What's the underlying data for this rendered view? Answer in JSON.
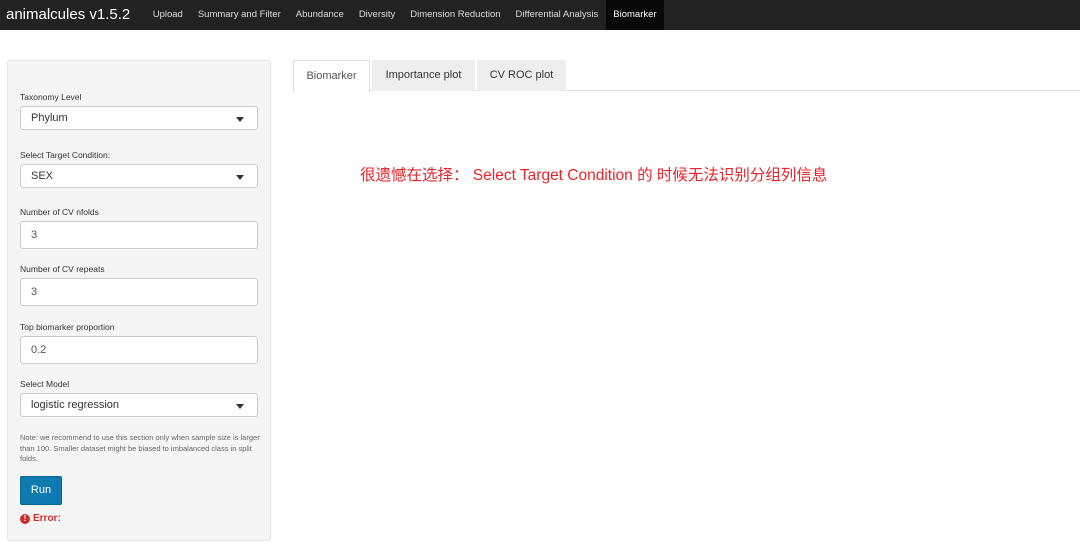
{
  "navbar": {
    "brand": "animalcules v1.5.2",
    "items": [
      {
        "label": "Upload"
      },
      {
        "label": "Summary and Filter"
      },
      {
        "label": "Abundance"
      },
      {
        "label": "Diversity"
      },
      {
        "label": "Dimension Reduction"
      },
      {
        "label": "Differential Analysis"
      },
      {
        "label": "Biomarker"
      }
    ],
    "active": "Biomarker"
  },
  "sidebar": {
    "taxonomy_level": {
      "label": "Taxonomy Level",
      "value": "Phylum"
    },
    "target_condition": {
      "label": "Select Target Condition:",
      "value": "SEX"
    },
    "cv_nfolds": {
      "label": "Number of CV nfolds",
      "value": "3"
    },
    "cv_repeats": {
      "label": "Number of CV repeats",
      "value": "3"
    },
    "top_proportion": {
      "label": "Top biomarker proportion",
      "value": "0.2"
    },
    "model": {
      "label": "Select Model",
      "value": "logistic regression"
    },
    "note": "Note: we recommend to use this section only when sample size is larger than 100. Smaller dataset might be biased to imbalanced class in split folds.",
    "run_label": "Run",
    "error_label": "Error:"
  },
  "tabs": [
    {
      "label": "Biomarker",
      "active": true
    },
    {
      "label": "Importance plot",
      "active": false
    },
    {
      "label": "CV ROC plot",
      "active": false
    }
  ],
  "annotation": "很遗憾在选择： Select Target Condition 的 时候无法识别分组列信息",
  "colors": {
    "navbar_bg": "#222222",
    "run_button": "#0d7ab0",
    "error": "#c9302c",
    "annotation": "#e8242a"
  }
}
